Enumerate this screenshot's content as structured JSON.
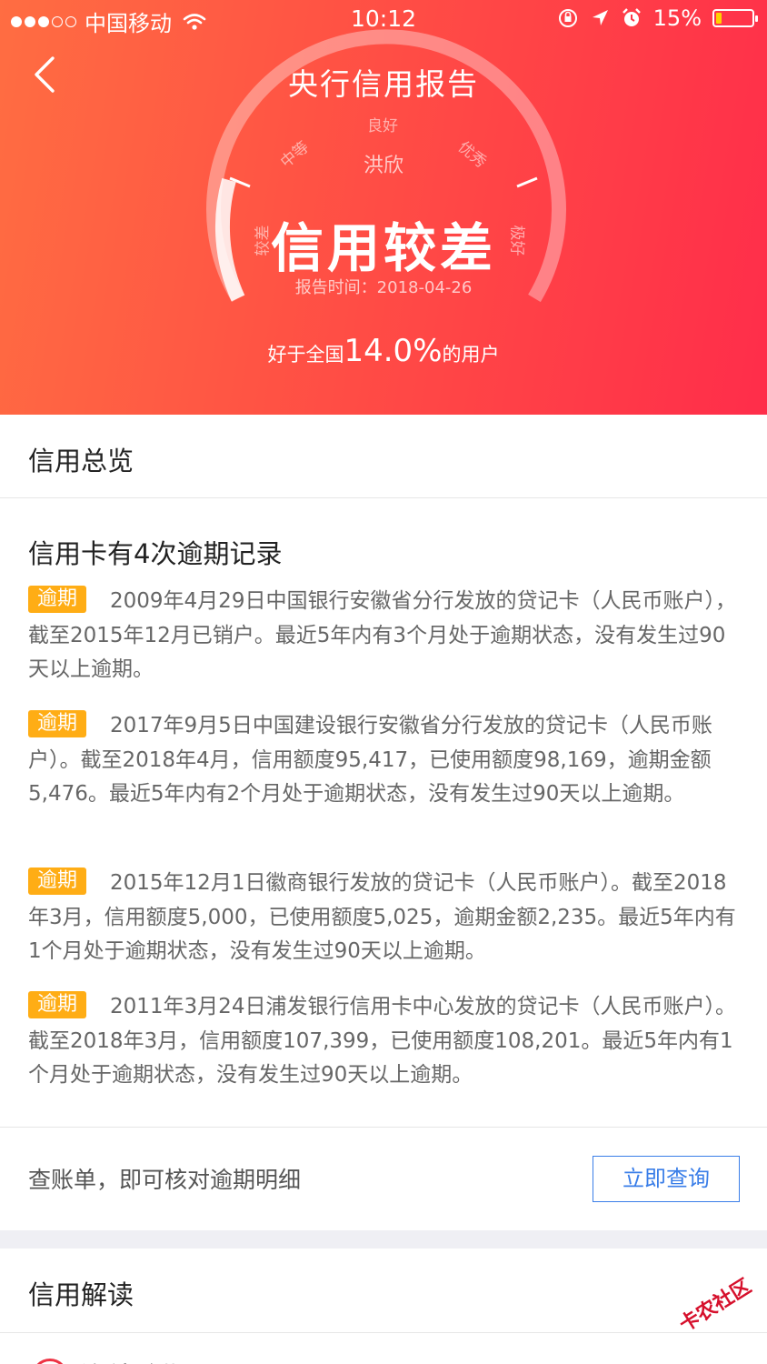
{
  "status_bar": {
    "carrier": "中国移动",
    "time": "10:12",
    "battery_pct": "15%",
    "battery_level": 0.15,
    "battery_color": "#ffd200"
  },
  "nav": {
    "back_icon": "chevron-left-icon",
    "title": "央行信用报告"
  },
  "score": {
    "gauge_labels": [
      "较差",
      "中等",
      "良好",
      "优秀",
      "极好"
    ],
    "user_name": "洪欣",
    "level": "信用较差",
    "report_time": "报告时间：2018-04-26",
    "better_prefix": "好于全国",
    "better_pct": "14.0%",
    "better_suffix": "的用户"
  },
  "overview": {
    "title": "信用总览",
    "heading": "信用卡有4次逾期记录",
    "tag_label": "逾期",
    "tag_color": "#ffad15",
    "records": [
      "2009年4月29日中国银行安徽省分行发放的贷记卡（人民币账户），截至2015年12月已销户。最近5年内有3个月处于逾期状态，没有发生过90天以上逾期。",
      "2017年9月5日中国建设银行安徽省分行发放的贷记卡（人民币账户）。截至2018年4月，信用额度95,417，已使用额度98,169，逾期金额5,476。最近5年内有2个月处于逾期状态，没有发生过90天以上逾期。",
      "2015年12月1日徽商银行发放的贷记卡（人民币账户）。截至2018年3月，信用额度5,000，已使用额度5,025，逾期金额2,235。最近5年内有1个月处于逾期状态，没有发生过90天以上逾期。",
      "2011年3月24日浦发银行信用卡中心发放的贷记卡（人民币账户）。截至2018年3月，信用额度107,399，已使用额度108,201。最近5年内有1个月处于逾期状态，没有发生过90天以上逾期。"
    ]
  },
  "cta": {
    "text": "查账单，即可核对逾期明细",
    "button": "立即查询",
    "button_color": "#3a7ee8"
  },
  "interpretation": {
    "title": "信用解读",
    "first_item": "连续逾期"
  },
  "watermark": "卡农社区"
}
